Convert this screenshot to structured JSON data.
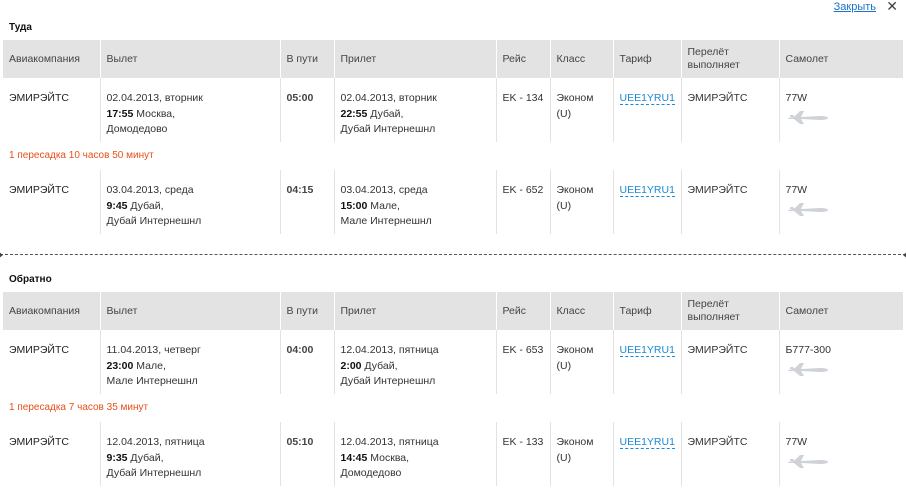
{
  "close_label": "Закрыть",
  "close_icon": "✕",
  "columns": [
    "Авиакомпания",
    "Вылет",
    "В пути",
    "Прилет",
    "Рейс",
    "Класс",
    "Тариф",
    "Перелёт выполняет",
    "Самолет"
  ],
  "outbound": {
    "title": "Туда",
    "seg1": {
      "airline": "ЭМИРЭЙТС",
      "dep_date": "02.04.2013, вторник",
      "dep_time": "17:55",
      "dep_city": " Москва,",
      "dep_airport": "Домодедово",
      "duration": "05:00",
      "arr_date": "02.04.2013, вторник",
      "arr_time": "22:55",
      "arr_city": " Дубай,",
      "arr_airport": "Дубай Интернешнл",
      "flight": "EK - 134",
      "class_name": "Эконом",
      "class_code": "(U)",
      "fare": "UEE1YRU1",
      "operator": "ЭМИРЭЙТС",
      "aircraft": "77W"
    },
    "transfer": "1 пересадка 10 часов 50 минут",
    "seg2": {
      "airline": "ЭМИРЭЙТС",
      "dep_date": "03.04.2013, среда",
      "dep_time": "9:45",
      "dep_city": " Дубай,",
      "dep_airport": "Дубай Интернешнл",
      "duration": "04:15",
      "arr_date": "03.04.2013, среда",
      "arr_time": "15:00",
      "arr_city": " Мале,",
      "arr_airport": "Мале Интернешнл",
      "flight": "EK - 652",
      "class_name": "Эконом",
      "class_code": "(U)",
      "fare": "UEE1YRU1",
      "operator": "ЭМИРЭЙТС",
      "aircraft": "77W"
    }
  },
  "return": {
    "title": "Обратно",
    "seg1": {
      "airline": "ЭМИРЭЙТС",
      "dep_date": "11.04.2013, четверг",
      "dep_time": "23:00",
      "dep_city": " Мале,",
      "dep_airport": "Мале Интернешнл",
      "duration": "04:00",
      "arr_date": "12.04.2013, пятница",
      "arr_time": "2:00",
      "arr_city": " Дубай,",
      "arr_airport": "Дубай Интернешнл",
      "flight": "EK - 653",
      "class_name": "Эконом",
      "class_code": "(U)",
      "fare": "UEE1YRU1",
      "operator": "ЭМИРЭЙТС",
      "aircraft": "Б777-300"
    },
    "transfer": "1 пересадка 7 часов 35 минут",
    "seg2": {
      "airline": "ЭМИРЭЙТС",
      "dep_date": "12.04.2013, пятница",
      "dep_time": "9:35",
      "dep_city": " Дубай,",
      "dep_airport": "Дубай Интернешнл",
      "duration": "05:10",
      "arr_date": "12.04.2013, пятница",
      "arr_time": "14:45",
      "arr_city": " Москва,",
      "arr_airport": "Домодедово",
      "flight": "EK - 133",
      "class_name": "Эконом",
      "class_code": "(U)",
      "fare": "UEE1YRU1",
      "operator": "ЭМИРЭЙТС",
      "aircraft": "77W"
    }
  }
}
